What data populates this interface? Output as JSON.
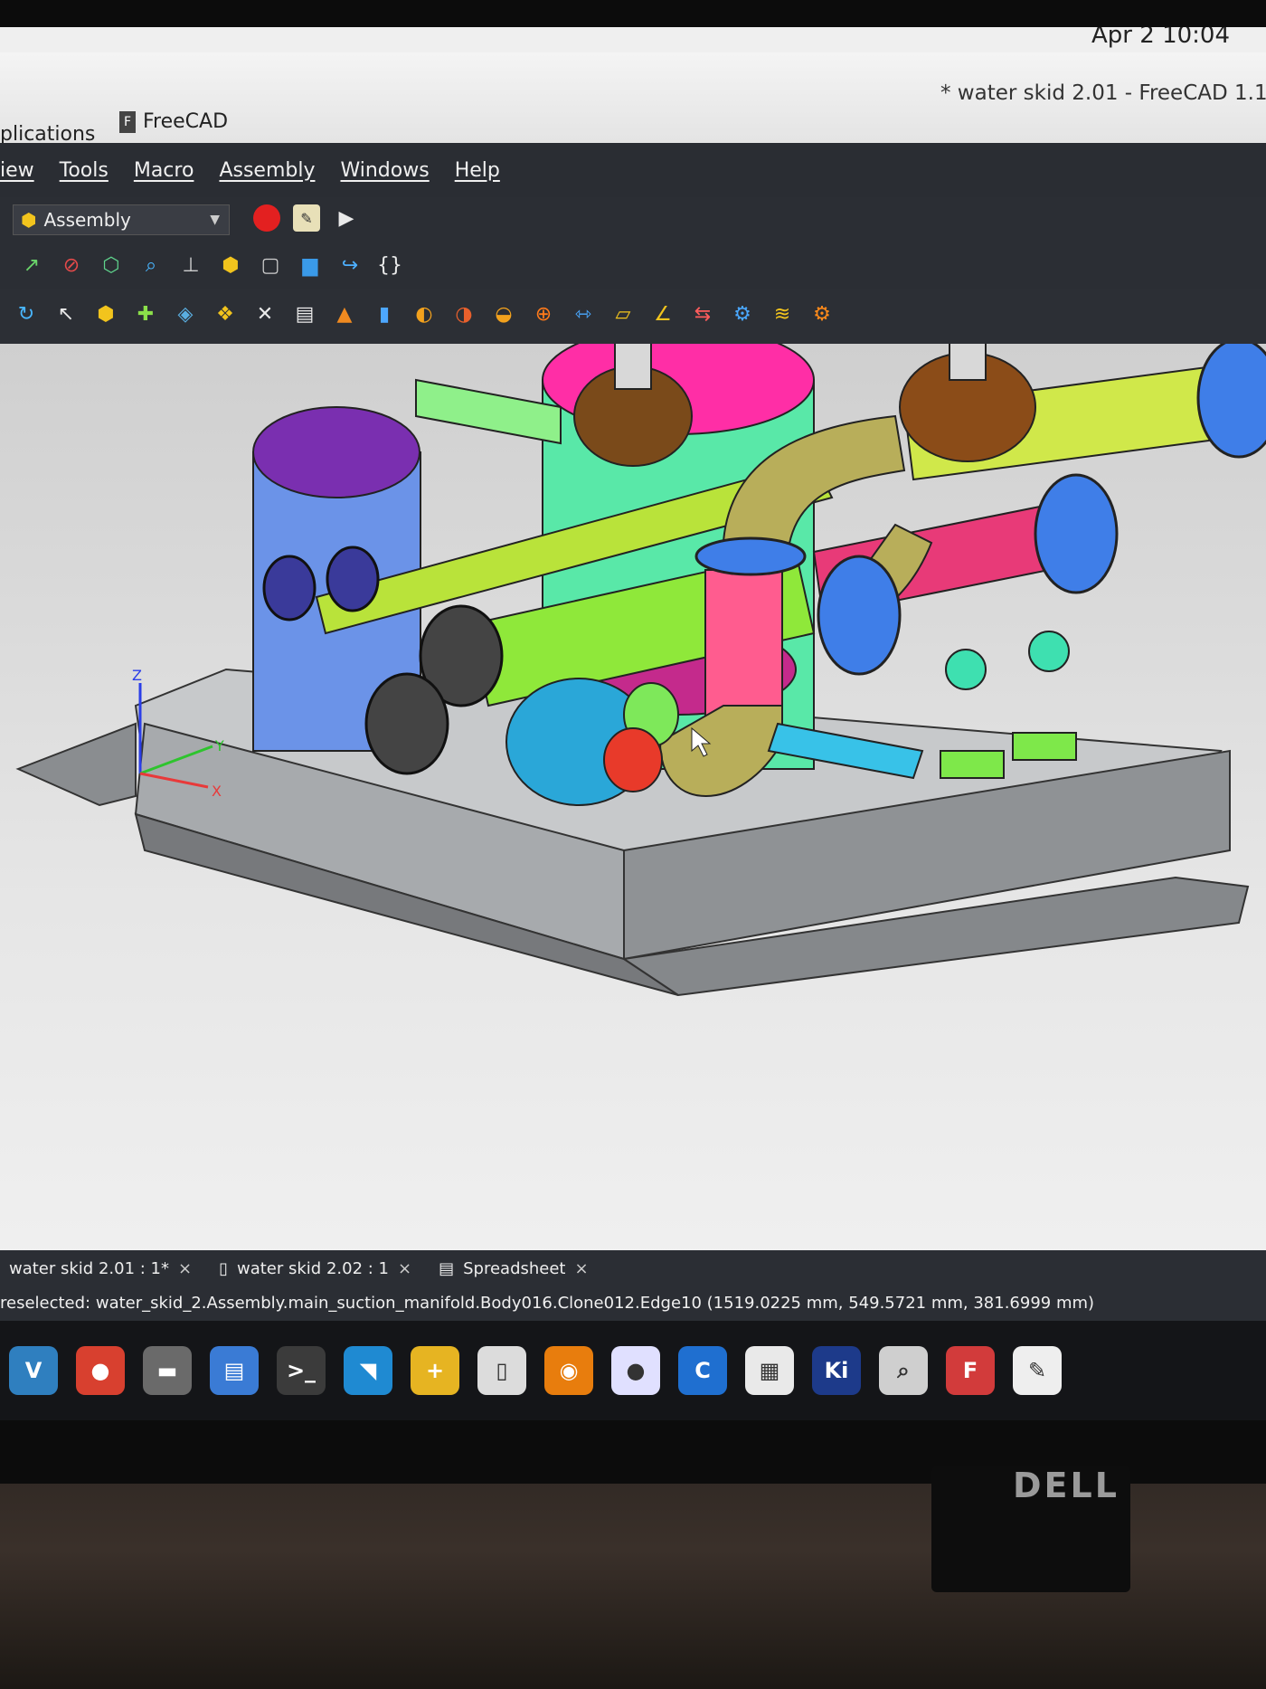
{
  "clock": "Apr 2 10:04",
  "panel": {
    "applications": "plications",
    "app_name": "FreeCAD"
  },
  "window_title": "* water skid 2.01 - FreeCAD 1.1",
  "menu": [
    "iew",
    "Tools",
    "Macro",
    "Assembly",
    "Windows",
    "Help"
  ],
  "workbench": "Assembly",
  "macro_toolbar": [
    "record-icon",
    "macro-editor-icon",
    "play-icon"
  ],
  "toolbar_icons": [
    "std-icon",
    "view-icon",
    "zoom-icon",
    "measure-icon",
    "part-icon",
    "box-icon",
    "folder-icon",
    "link-icon",
    "braces-icon"
  ],
  "assembly_icons": [
    "insert-icon",
    "ground-icon",
    "joint-fixed-icon",
    "joint-revolute-icon",
    "joint-cylindrical-icon",
    "joint-slider-icon",
    "joint-ball-icon",
    "joint-distance-icon",
    "simulation-icon",
    "explode-icon",
    "gear-icon"
  ],
  "doc_tabs": [
    {
      "label": "water skid 2.01 : 1*",
      "close": "×"
    },
    {
      "label": "water skid 2.02 : 1",
      "close": "×"
    },
    {
      "label": "Spreadsheet",
      "close": "×"
    }
  ],
  "status": "reselected: water_skid_2.Assembly.main_suction_manifold.Body016.Clone012.Edge10 (1519.0225 mm, 549.5721 mm, 381.6999 mm)",
  "axes": {
    "z": "Z",
    "y": "Y",
    "x": "X"
  },
  "dock_apps": [
    {
      "name": "vim-icon",
      "glyph": "V",
      "color": "#2f7fbf"
    },
    {
      "name": "chrome-icon",
      "glyph": "●",
      "color": "#d8402f"
    },
    {
      "name": "files-icon",
      "glyph": "▬",
      "color": "#6a6a6a"
    },
    {
      "name": "writer-icon",
      "glyph": "▤",
      "color": "#3a7bd5"
    },
    {
      "name": "terminal-icon",
      "glyph": ">_",
      "color": "#3b3b3b"
    },
    {
      "name": "vscode-icon",
      "glyph": "◥",
      "color": "#1f8ad2"
    },
    {
      "name": "calculator-icon",
      "glyph": "+",
      "color": "#e6b422"
    },
    {
      "name": "panel-icon",
      "glyph": "▯",
      "color": "#dcdcdc"
    },
    {
      "name": "blender-icon",
      "glyph": "◉",
      "color": "#e87d0d"
    },
    {
      "name": "capture-icon",
      "glyph": "●",
      "color": "#e0e0ff"
    },
    {
      "name": "c-app-icon",
      "glyph": "C",
      "color": "#1f6fd0"
    },
    {
      "name": "document-viewer-icon",
      "glyph": "▦",
      "color": "#e9e9e9"
    },
    {
      "name": "kicad-icon",
      "glyph": "Ki",
      "color": "#1d3a8a"
    },
    {
      "name": "search-icon",
      "glyph": "⌕",
      "color": "#cfcfcf"
    },
    {
      "name": "freecad-icon",
      "glyph": "F",
      "color": "#d23b3b"
    },
    {
      "name": "chat-icon",
      "glyph": "✎",
      "color": "#eeeeee"
    }
  ],
  "brand": "DELL"
}
